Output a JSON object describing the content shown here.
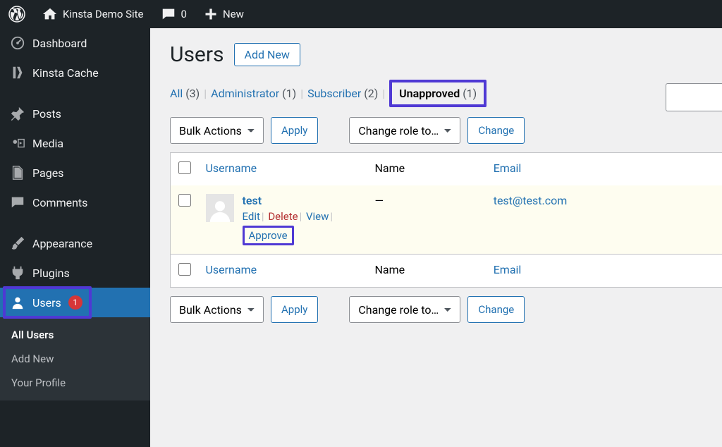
{
  "adminbar": {
    "site_name": "Kinsta Demo Site",
    "comments_count": "0",
    "new_label": "New"
  },
  "sidebar": {
    "dashboard": "Dashboard",
    "kinsta_cache": "Kinsta Cache",
    "posts": "Posts",
    "media": "Media",
    "pages": "Pages",
    "comments": "Comments",
    "appearance": "Appearance",
    "plugins": "Plugins",
    "users": "Users",
    "users_badge": "1",
    "submenu": {
      "all_users": "All Users",
      "add_new": "Add New",
      "profile": "Your Profile"
    }
  },
  "page": {
    "title": "Users",
    "add_new": "Add New"
  },
  "filters": {
    "all": "All",
    "all_count": "(3)",
    "admin": "Administrator",
    "admin_count": "(1)",
    "subscriber": "Subscriber",
    "subscriber_count": "(2)",
    "unapproved": "Unapproved",
    "unapproved_count": "(1)"
  },
  "bulk": {
    "actions": "Bulk Actions",
    "apply": "Apply",
    "change_role": "Change role to…",
    "change": "Change"
  },
  "cols": {
    "username": "Username",
    "name": "Name",
    "email": "Email"
  },
  "row": {
    "username": "test",
    "name": "—",
    "email": "test@test.com",
    "edit": "Edit",
    "delete": "Delete",
    "view": "View",
    "approve": "Approve"
  }
}
